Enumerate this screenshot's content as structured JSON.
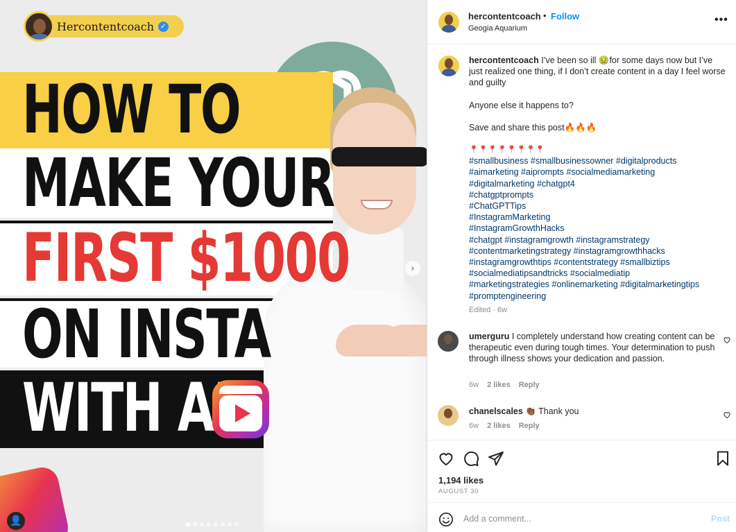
{
  "post": {
    "brand_name": "Hercontentcoach",
    "headline": [
      "HOW TO",
      "MAKE YOUR",
      "FIRST $1000",
      "ON INSTA",
      "WITH AI"
    ],
    "carousel_dots": 8,
    "carousel_active": 0
  },
  "header": {
    "username": "hercontentcoach",
    "separator": "•",
    "follow_label": "Follow",
    "location": "Geogia Aquarium",
    "more_label": "•••"
  },
  "caption": {
    "username": "hercontentcoach",
    "line1": " I’ve been so ill 🤢for some days now but I’ve just realized one thing, if I don’t create content in a day I feel worse and guilty",
    "line2": "Anyone else it happens to?",
    "line3": "Save and share this post🔥🔥🔥",
    "pins": "📍📍📍📍📍📍📍📍",
    "hashtag_lines": [
      "#smallbusiness #smallbusinessowner #digitalproducts",
      "#aimarketing #aiprompts #socialmediamarketing",
      "#digitalmarketing #chatgpt4",
      "#chatgptprompts",
      "#ChatGPTTips",
      "#InstagramMarketing",
      "#InstagramGrowthHacks",
      "#chatgpt #instagramgrowth #instagramstrategy",
      "#contentmarketingstrategy #instagramgrowthhacks",
      "#instagramgrowthtips #contentstrategy #smallbiztips",
      "#socialmediatipsandtricks #socialmediatip",
      "#marketingstrategies #onlinemarketing #digitalmarketingtips",
      "#promptengineering"
    ],
    "edited": "Edited · 6w"
  },
  "comments": [
    {
      "username": "umerguru",
      "text": " I completely understand how creating content can be therapeutic even during tough times. Your determination to push through illness shows your dedication and passion.",
      "time": "6w",
      "likes": "2 likes",
      "reply": "Reply"
    },
    {
      "username": "chanelscales",
      "text": " 👏🏾 Thank you",
      "time": "6w",
      "likes": "2 likes",
      "reply": "Reply"
    }
  ],
  "stats": {
    "likes": "1,194 likes",
    "date": "AUGUST 30"
  },
  "composer": {
    "placeholder": "Add a comment...",
    "post_label": "Post"
  },
  "colors": {
    "accent": "#0095f6",
    "hashtag": "#00376b",
    "muted": "#8e8e8e",
    "headline_red": "#e53935",
    "band_yellow": "#f8cf45"
  },
  "icons": [
    "verified-icon",
    "more-icon",
    "heart-icon",
    "comment-icon",
    "share-icon",
    "bookmark-icon",
    "emoji-icon",
    "next-arrow-icon",
    "user-tag-icon",
    "openai-logo-icon",
    "reels-logo-icon"
  ]
}
